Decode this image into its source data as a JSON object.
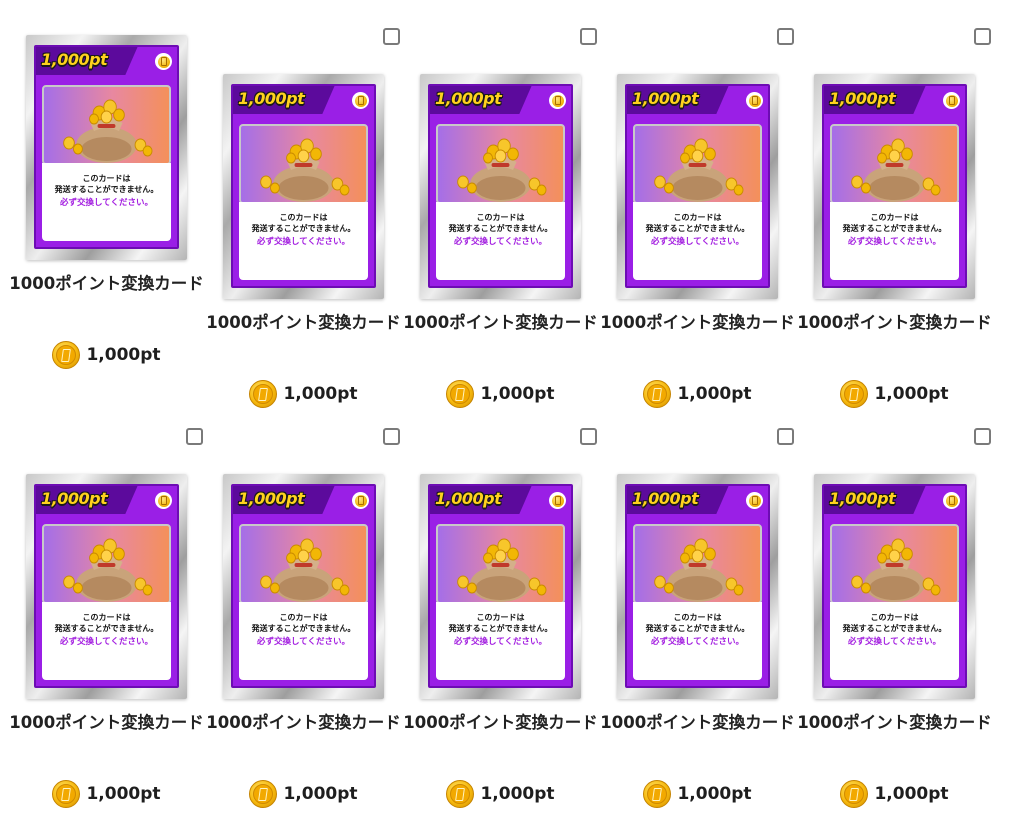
{
  "items": [
    {
      "card_pt": "1,000pt",
      "card_line1": "このカードは",
      "card_line2": "発送することができません。",
      "card_line3": "必ず交換してください。",
      "name": "1000ポイント変換カード",
      "price": "1,000pt",
      "selected": true
    },
    {
      "card_pt": "1,000pt",
      "card_line1": "このカードは",
      "card_line2": "発送することができません。",
      "card_line3": "必ず交換してください。",
      "name": "1000ポイント変換カード",
      "price": "1,000pt",
      "selected": false
    },
    {
      "card_pt": "1,000pt",
      "card_line1": "このカードは",
      "card_line2": "発送することができません。",
      "card_line3": "必ず交換してください。",
      "name": "1000ポイント変換カード",
      "price": "1,000pt",
      "selected": false
    },
    {
      "card_pt": "1,000pt",
      "card_line1": "このカードは",
      "card_line2": "発送することができません。",
      "card_line3": "必ず交換してください。",
      "name": "1000ポイント変換カード",
      "price": "1,000pt",
      "selected": false
    },
    {
      "card_pt": "1,000pt",
      "card_line1": "このカードは",
      "card_line2": "発送することができません。",
      "card_line3": "必ず交換してください。",
      "name": "1000ポイント変換カード",
      "price": "1,000pt",
      "selected": false
    },
    {
      "card_pt": "1,000pt",
      "card_line1": "このカードは",
      "card_line2": "発送することができません。",
      "card_line3": "必ず交換してください。",
      "name": "1000ポイント変換カード",
      "price": "1,000pt",
      "selected": false
    },
    {
      "card_pt": "1,000pt",
      "card_line1": "このカードは",
      "card_line2": "発送することができません。",
      "card_line3": "必ず交換してください。",
      "name": "1000ポイント変換カード",
      "price": "1,000pt",
      "selected": false
    },
    {
      "card_pt": "1,000pt",
      "card_line1": "このカードは",
      "card_line2": "発送することができません。",
      "card_line3": "必ず交換してください。",
      "name": "1000ポイント変換カード",
      "price": "1,000pt",
      "selected": false
    },
    {
      "card_pt": "1,000pt",
      "card_line1": "このカードは",
      "card_line2": "発送することができません。",
      "card_line3": "必ず交換してください。",
      "name": "1000ポイント変換カード",
      "price": "1,000pt",
      "selected": false
    },
    {
      "card_pt": "1,000pt",
      "card_line1": "このカードは",
      "card_line2": "発送することができません。",
      "card_line3": "必ず交換してください。",
      "name": "1000ポイント変換カード",
      "price": "1,000pt",
      "selected": false
    }
  ],
  "icons": {
    "price_icon": "point-coin-icon",
    "card_badge_icon": "coin-badge-icon",
    "checkbox_icon": "checkbox-icon",
    "card_art": "coin-bag-image"
  },
  "colors": {
    "card_purple": "#9a1fe6",
    "card_frame": "#a9a9a9",
    "notice_text": "#a31fe0",
    "pt_title": "#ffd21e",
    "coin_gold": "#f6b90e",
    "checkbox_border": "#7a7a7a"
  }
}
